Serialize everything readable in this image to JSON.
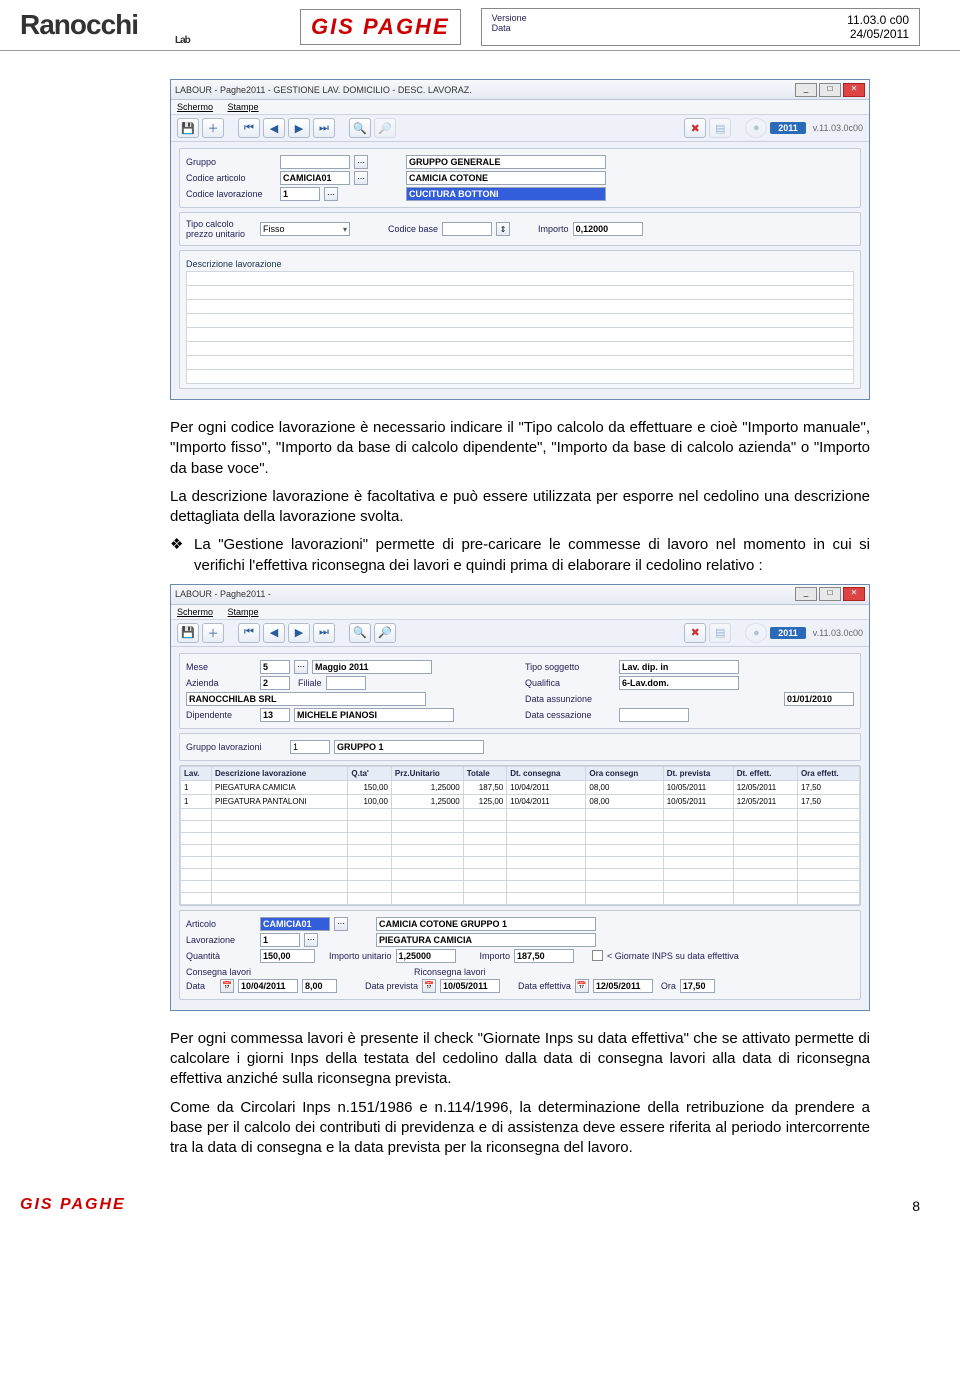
{
  "header": {
    "brand": "Ranocchi",
    "brand_sub": "Lab",
    "product": "GIS PAGHE",
    "ver_label": "Versione",
    "date_label": "Data",
    "ver": "11.03.0 c00",
    "date": "24/05/2011"
  },
  "win1": {
    "title": "LABOUR - Paghe2011 - GESTIONE LAV. DOMICILIO - DESC. LAVORAZ.",
    "menu1": "Schermo",
    "menu2": "Stampe",
    "year": "2011",
    "ver": "v.11.03.0c00",
    "lbl_gruppo": "Gruppo",
    "val_gruppo_desc": "GRUPPO GENERALE",
    "lbl_codart": "Codice articolo",
    "val_codart": "CAMICIA01",
    "val_codart_desc": "CAMICIA COTONE",
    "lbl_codlav": "Codice lavorazione",
    "val_codlav": "1",
    "val_codlav_desc": "CUCITURA BOTTONI",
    "lbl_tipocalc": "Tipo calcolo prezzo unitario",
    "val_tipocalc": "Fisso",
    "lbl_codbase": "Codice base",
    "lbl_importo": "Importo",
    "val_importo": "0,12000",
    "lbl_desclav": "Descrizione lavorazione"
  },
  "para1": "Per ogni codice lavorazione è necessario indicare il \"Tipo calcolo da effettuare e cioè \"Importo manuale\", \"Importo fisso\", \"Importo da base di calcolo dipendente\", \"Importo da base di calcolo azienda\" o \"Importo da base voce\".",
  "para2": "La descrizione lavorazione è facoltativa e può essere utilizzata per esporre nel cedolino una descrizione dettagliata della lavorazione svolta.",
  "bullet1": "La \"Gestione lavorazioni\" permette di pre-caricare le commesse di lavoro nel momento in cui si verifichi l'effettiva riconsegna dei lavori e quindi prima di elaborare il cedolino relativo :",
  "win2": {
    "title": "LABOUR - Paghe2011 -",
    "menu1": "Schermo",
    "menu2": "Stampe",
    "year": "2011",
    "ver": "v.11.03.0c00",
    "lbl_mese": "Mese",
    "val_mese": "5",
    "val_mese_desc": "Maggio  2011",
    "lbl_azienda": "Azienda",
    "val_azienda": "2",
    "val_filiale": "Filiale",
    "azienda_name": "RANOCCHILAB SRL",
    "lbl_dip": "Dipendente",
    "val_dip": "13",
    "val_dip_desc": "MICHELE PIANOSI",
    "lbl_tiposogg": "Tipo soggetto",
    "val_tiposogg": "Lav. dip. in",
    "lbl_qualifica": "Qualifica",
    "val_qualifica": "6-Lav.dom.",
    "lbl_dataass": "Data assunzione",
    "val_dataass": "01/01/2010",
    "lbl_datacess": "Data cessazione",
    "lbl_gruppo": "Gruppo lavorazioni",
    "val_gruppo": "1",
    "val_gruppo_desc": "GRUPPO 1",
    "th": [
      "Lav.",
      "Descrizione lavorazione",
      "Q.ta'",
      "Prz.Unitario",
      "Totale",
      "Dt. consegna",
      "Ora consegn",
      "Dt. prevista",
      "Dt. effett.",
      "Ora effett."
    ],
    "rows": [
      [
        "1",
        "PIEGATURA CAMICIA",
        "150,00",
        "1,25000",
        "187,50",
        "10/04/2011",
        "08,00",
        "10/05/2011",
        "12/05/2011",
        "17,50"
      ],
      [
        "1",
        "PIEGATURA PANTALONI",
        "100,00",
        "1,25000",
        "125,00",
        "10/04/2011",
        "08,00",
        "10/05/2011",
        "12/05/2011",
        "17,50"
      ]
    ],
    "lbl_articolo": "Articolo",
    "val_articolo": "CAMICIA01",
    "val_art_desc": "CAMICIA COTONE GRUPPO 1",
    "lbl_lavorazione": "Lavorazione",
    "val_lavorazione": "1",
    "val_lav_desc": "PIEGATURA CAMICIA",
    "lbl_quantita": "Quantità",
    "val_quantita": "150,00",
    "lbl_impunit": "Importo unitario",
    "val_impunit": "1,25000",
    "lbl_importo": "Importo",
    "val_importo": "187,50",
    "chk_text": "< Giornate INPS su data effettiva",
    "lbl_consegna": "Consegna lavori",
    "lbl_riconsegna": "Riconsegna lavori",
    "lbl_data": "Data",
    "val_data_cons": "10/04/2011",
    "val_ora_cons": "8,00",
    "lbl_dataprev": "Data prevista",
    "val_dataprev": "10/05/2011",
    "lbl_dataeff": "Data effettiva",
    "val_dataeff": "12/05/2011",
    "lbl_ora": "Ora",
    "val_ora_eff": "17,50"
  },
  "para3": "Per ogni commessa lavori è presente il check \"Giornate Inps su data effettiva\" che se attivato permette di calcolare i giorni Inps della testata del cedolino dalla data di consegna lavori alla data di riconsegna effettiva anziché sulla riconsegna prevista.",
  "para4": "Come da Circolari Inps n.151/1986 e n.114/1996, la determinazione della retribuzione da prendere a base per il calcolo dei contributi di previdenza e di assistenza deve essere riferita al periodo intercorrente tra la data di consegna e la data prevista per la riconsegna del lavoro.",
  "footer": {
    "product": "GIS PAGHE",
    "page": "8"
  }
}
